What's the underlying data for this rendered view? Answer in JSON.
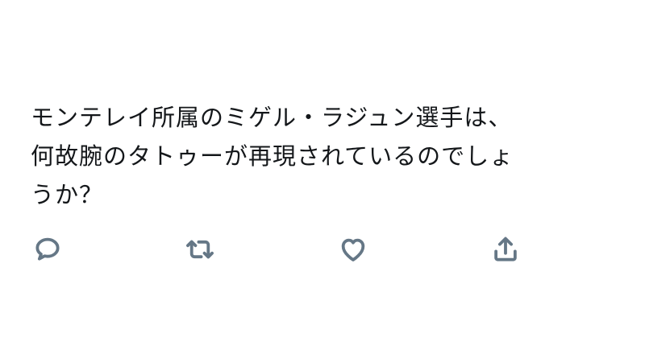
{
  "tweet": {
    "lines": [
      "モンテレイ所属のミゲル・ラジュン選手は、",
      "何故腕のタトゥーが再現されているのでしょ",
      "うか？"
    ]
  },
  "actions": {
    "reply_icon": "reply-icon",
    "retweet_icon": "retweet-icon",
    "like_icon": "heart-icon",
    "share_icon": "share-icon"
  },
  "colors": {
    "text": "#14171a",
    "icon": "#657786"
  }
}
